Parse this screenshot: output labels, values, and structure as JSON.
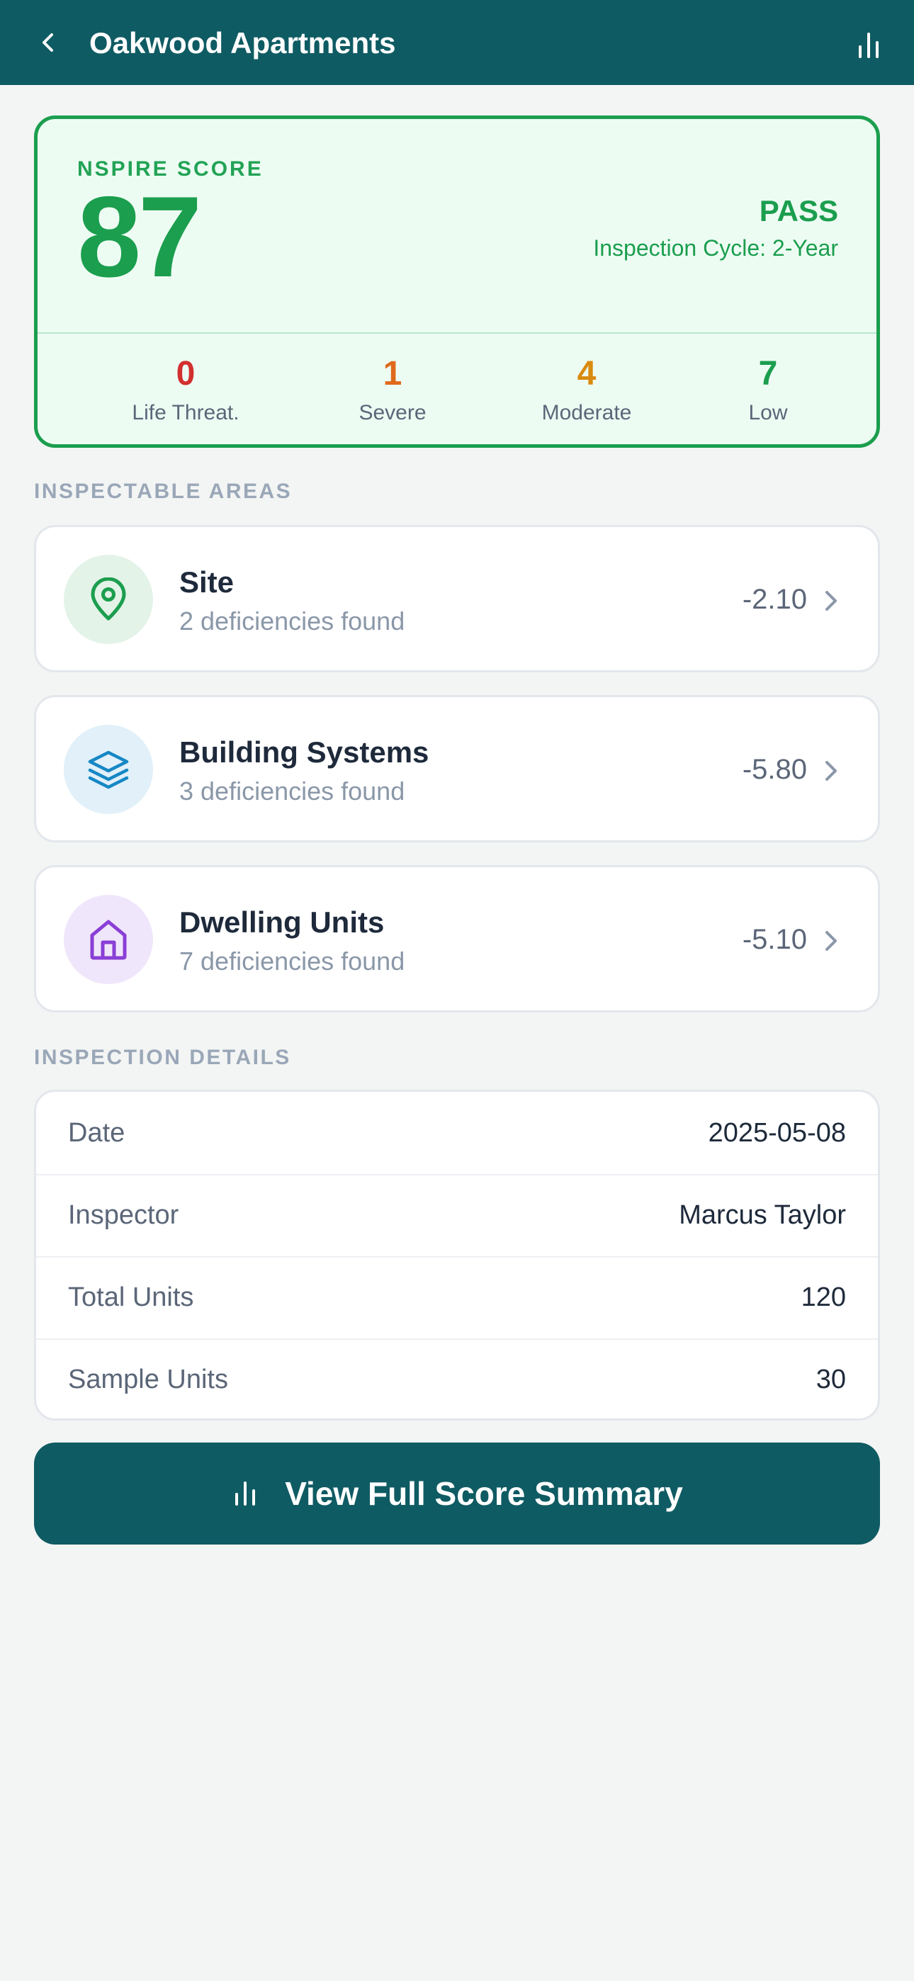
{
  "header": {
    "title": "Oakwood Apartments",
    "back_icon": "chevron-left-icon",
    "chart_icon": "bar-chart-icon"
  },
  "score": {
    "label": "NSPIRE SCORE",
    "value": "87",
    "result": "PASS",
    "cycle": "Inspection Cycle: 2-Year",
    "severity": [
      {
        "count": "0",
        "label": "Life Threat.",
        "color": "#d32f2f"
      },
      {
        "count": "1",
        "label": "Severe",
        "color": "#e0691b"
      },
      {
        "count": "4",
        "label": "Moderate",
        "color": "#d98a10"
      },
      {
        "count": "7",
        "label": "Low",
        "color": "#1b9e4e"
      }
    ],
    "accent_color": "#1b9e4e"
  },
  "areas": {
    "title": "INSPECTABLE AREAS",
    "items": [
      {
        "name": "Site",
        "sub": "2 deficiencies found",
        "score": "-2.10",
        "icon": "map-pin-icon",
        "icon_color": "#1b9e4e",
        "icon_bg": "#e3f3e8"
      },
      {
        "name": "Building Systems",
        "sub": "3 deficiencies found",
        "score": "-5.80",
        "icon": "layers-icon",
        "icon_color": "#1687c5",
        "icon_bg": "#e1f0f9"
      },
      {
        "name": "Dwelling Units",
        "sub": "7 deficiencies found",
        "score": "-5.10",
        "icon": "home-icon",
        "icon_color": "#8a3fd6",
        "icon_bg": "#f0e6fb"
      }
    ]
  },
  "details": {
    "title": "INSPECTION DETAILS",
    "rows": [
      {
        "label": "Date",
        "value": "2025-05-08"
      },
      {
        "label": "Inspector",
        "value": "Marcus Taylor"
      },
      {
        "label": "Total Units",
        "value": "120"
      },
      {
        "label": "Sample Units",
        "value": "30"
      }
    ]
  },
  "cta": {
    "label": "View Full Score Summary",
    "icon": "bar-chart-icon"
  },
  "colors": {
    "primary": "#0f5b63",
    "pass": "#1b9e4e",
    "background": "#f3f5f4"
  }
}
